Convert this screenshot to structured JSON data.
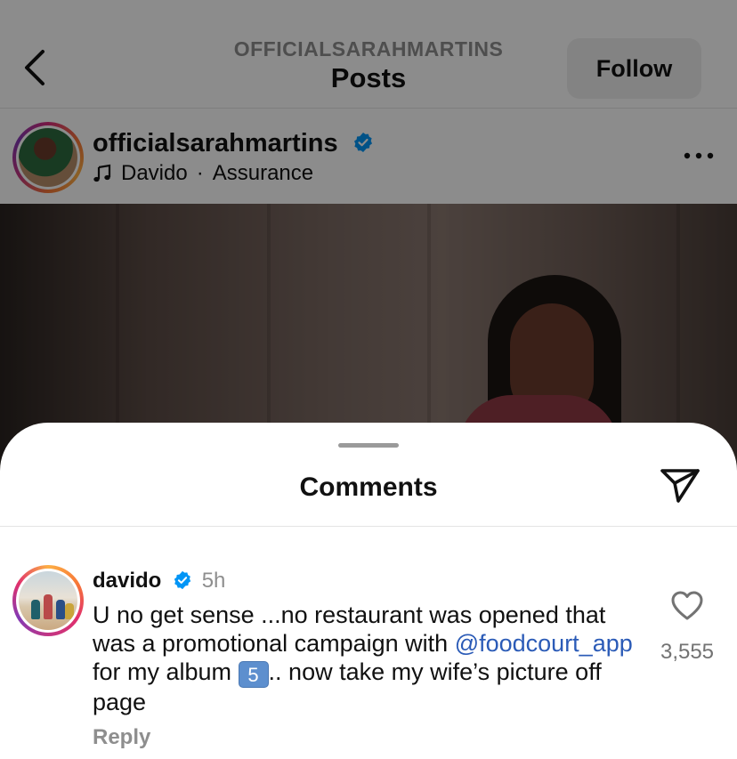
{
  "header": {
    "account_handle": "OFFICIALSARAHMARTINS",
    "title": "Posts",
    "follow_label": "Follow",
    "back_icon": "chevron-left-icon"
  },
  "post": {
    "username": "officialsarahmartins",
    "verified": true,
    "music": {
      "artist": "Davido",
      "separator": "·",
      "track": "Assurance",
      "icon": "music-note-icon"
    },
    "more_icon": "more-horizontal-icon"
  },
  "comments_sheet": {
    "title": "Comments",
    "share_icon": "paper-plane-icon",
    "comments": [
      {
        "username": "davido",
        "verified": true,
        "time": "5h",
        "text_part1": "U no get sense ...no restaurant was opened that was a promotional campaign with ",
        "mention": "@foodcourt_app",
        "text_part2": " for my album ",
        "emoji": "5",
        "text_part3": ".. now take my wife’s picture off page",
        "reply_label": "Reply",
        "like_count": "3,555",
        "like_icon": "heart-icon"
      }
    ]
  },
  "colors": {
    "verified_blue": "#0095f6",
    "mention_blue": "#2b5bb7",
    "secondary_text": "#8e8e8e"
  }
}
